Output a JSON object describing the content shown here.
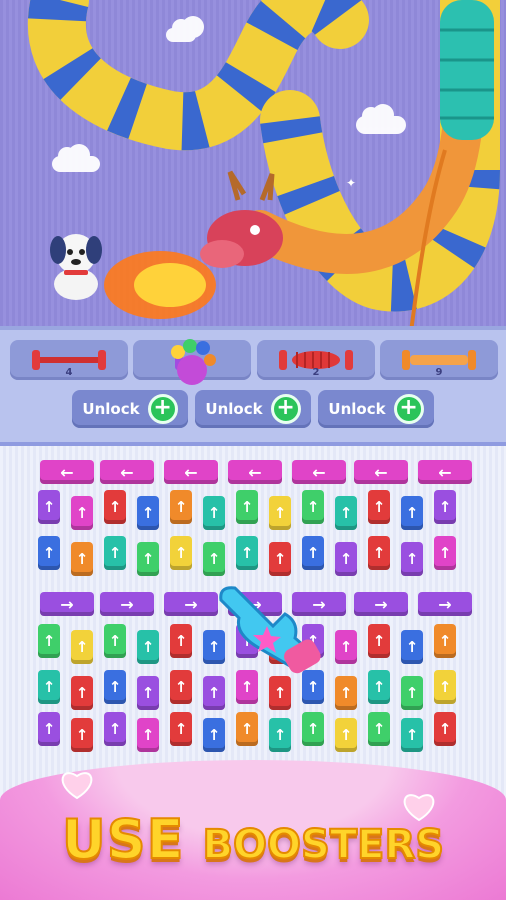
{
  "game": {
    "shelf": {
      "slots": [
        {
          "count_label": "4",
          "color": "#e23b3b"
        },
        {
          "count_label": "",
          "color": "#a24ce0"
        },
        {
          "count_label": "2",
          "color": "#e23b3b"
        },
        {
          "count_label": "9",
          "color": "#f08a2a"
        }
      ],
      "unlock_buttons": [
        {
          "label": "Unlock",
          "icon": "plus-icon"
        },
        {
          "label": "Unlock",
          "icon": "plus-icon"
        },
        {
          "label": "Unlock",
          "icon": "plus-icon"
        }
      ]
    },
    "board": {
      "arrow_up": "↑",
      "arrow_left": "←",
      "arrow_right": "→"
    },
    "banner": {
      "word1": "USE",
      "word2": "BOOSTERS"
    },
    "colors": {
      "pink": "#e044c8",
      "purple": "#9a4fe0",
      "red": "#e23b3b",
      "orange": "#f08a2a",
      "yellow": "#f2d23a",
      "green": "#3fcf6a",
      "teal": "#27c1a8",
      "blue": "#3a6fe0",
      "title_gold": "#ffd42a"
    },
    "characters": [
      "dragon-yarn-snake",
      "puppy",
      "paw-booster",
      "glove-cursor"
    ]
  }
}
